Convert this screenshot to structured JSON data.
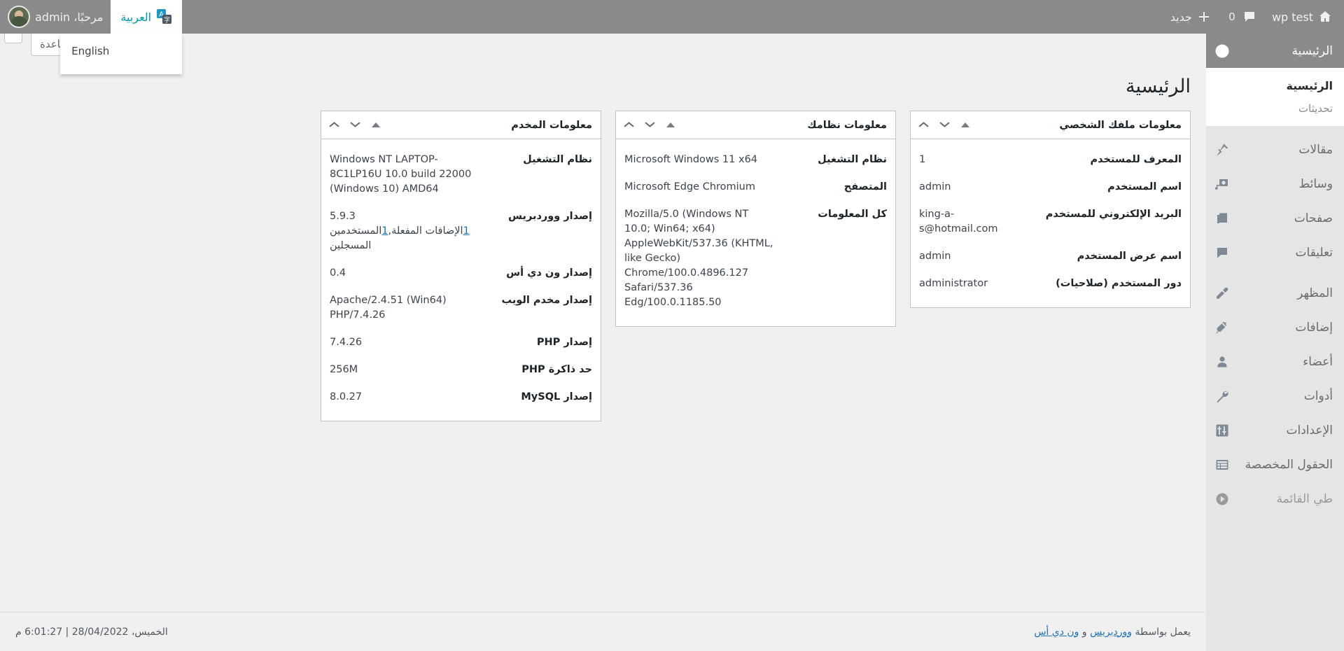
{
  "adminbar": {
    "home_icon": "wordpress-home-icon",
    "site_name": "wp test",
    "comment_icon": "comment-bubble-icon",
    "comment_count": "0",
    "new_icon": "plus-icon",
    "new_label": "جديد",
    "howdy": "مرحبًا، admin",
    "avatar": "user-avatar",
    "language": {
      "icon": "translate-icon",
      "current_label": "العربية",
      "accent_color": "#0097a7",
      "menu_items": [
        "English"
      ]
    }
  },
  "screen_meta": {
    "help_label": "مساعدة",
    "options_label": ""
  },
  "page": {
    "title": "الرئيسية"
  },
  "sidebar": {
    "items": [
      {
        "label": "الرئيسية",
        "icon": "dashboard-icon",
        "current": true
      },
      {
        "label": "مقالات",
        "icon": "pin-icon",
        "current": false
      },
      {
        "label": "وسائط",
        "icon": "media-icon",
        "current": false
      },
      {
        "label": "صفحات",
        "icon": "pages-icon",
        "current": false
      },
      {
        "label": "تعليقات",
        "icon": "comment-icon",
        "current": false
      },
      {
        "label": "المظهر",
        "icon": "appearance-brush-icon",
        "current": false
      },
      {
        "label": "إضافات",
        "icon": "plugin-icon",
        "current": false
      },
      {
        "label": "أعضاء",
        "icon": "users-icon",
        "current": false
      },
      {
        "label": "أدوات",
        "icon": "tools-wrench-icon",
        "current": false
      },
      {
        "label": "الإعدادات",
        "icon": "settings-sliders-icon",
        "current": false
      },
      {
        "label": "الحقول المخصصة",
        "icon": "custom-fields-icon",
        "current": false
      },
      {
        "label": "طي القائمة",
        "icon": "collapse-arrow-icon",
        "current": false
      }
    ],
    "submenu": {
      "dashboard": "الرئيسية",
      "updates": "تحديثات"
    }
  },
  "widgets": {
    "profile": {
      "title": "معلومات ملفك الشخصي",
      "rows": [
        {
          "key": "المعرف للمستخدم",
          "value": "1"
        },
        {
          "key": "اسم المستخدم",
          "value": "admin"
        },
        {
          "key": "البريد الإلكتروني للمستخدم",
          "value": "king-a-s@hotmail.com"
        },
        {
          "key": "اسم عرض المستخدم",
          "value": "admin"
        },
        {
          "key": "دور المستخدم (صلاحيات)",
          "value": "administrator"
        }
      ]
    },
    "system": {
      "title": "معلومات نظامك",
      "rows": [
        {
          "key": "نظام التشغيل",
          "value": "Microsoft Windows 11 x64"
        },
        {
          "key": "المتصفح",
          "value": "Microsoft Edge Chromium"
        },
        {
          "key": "كل المعلومات",
          "value": "Mozilla/5.0 (Windows NT 10.0; Win64; x64) AppleWebKit/537.36 (KHTML, like Gecko) Chrome/100.0.4896.127 Safari/537.36 Edg/100.0.1185.50"
        }
      ]
    },
    "server": {
      "title": "معلومات المخدم",
      "rows": [
        {
          "key": "نظام التشغيل",
          "value": "Windows NT LAPTOP-8C1LP16U 10.0 build 22000 (Windows 10) AMD64"
        },
        {
          "key": "إصدار ووردبريس",
          "value": "5.9.3"
        },
        {
          "key": "إصدار ون دي أس",
          "value": "0.4"
        },
        {
          "key": "إصدار مخدم الويب",
          "value": "Apache/2.4.51 (Win64) PHP/7.4.26"
        },
        {
          "key": "إصدار PHP",
          "value": "7.4.26"
        },
        {
          "key": "حد ذاكرة PHP",
          "value": "256M"
        },
        {
          "key": "إصدار MySQL",
          "value": "8.0.27"
        }
      ],
      "wp_extra": {
        "plugins_count": "1",
        "plugins_label": "الإضافات المفعلة",
        "users_count": "1",
        "users_label": "المستخدمين المسجلين"
      }
    }
  },
  "footer": {
    "credit_prefix": "يعمل بواسطة",
    "credit_link_1": "ووردبريس",
    "credit_and": "و",
    "credit_link_2": "ون دي أس",
    "timestamp": "الخميس، 28/04/2022 | 6:01:27 م"
  },
  "colors": {
    "adminbar_bg": "#8a8a8a",
    "sidebar_bg": "#e5e5e5",
    "content_bg": "#f0f0f1",
    "link": "#2271b1",
    "accent": "#0097a7"
  }
}
